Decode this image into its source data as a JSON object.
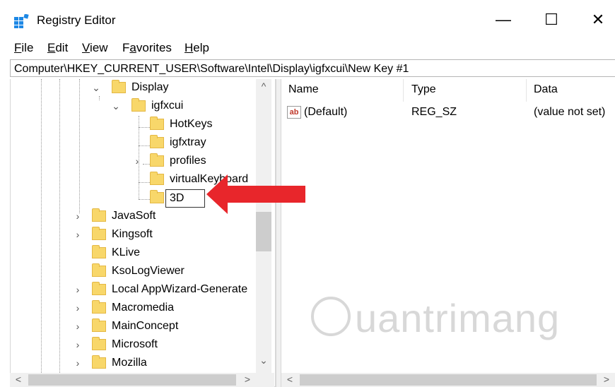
{
  "window": {
    "title": "Registry Editor",
    "minimize_glyph": "—",
    "maximize_glyph": "☐",
    "close_glyph": "✕"
  },
  "menu": {
    "file": {
      "accel": "F",
      "rest": "ile"
    },
    "edit": {
      "accel": "E",
      "rest": "dit"
    },
    "view": {
      "accel": "V",
      "rest": "iew"
    },
    "favorites": {
      "pre": "F",
      "accel": "a",
      "rest": "vorites"
    },
    "help": {
      "accel": "H",
      "rest": "elp"
    }
  },
  "address": "Computer\\HKEY_CURRENT_USER\\Software\\Intel\\Display\\igfxcui\\New Key #1",
  "tree": {
    "display": "Display",
    "igfxcui": "igfxcui",
    "hotkeys": "HotKeys",
    "igfxtray": "igfxtray",
    "profiles": "profiles",
    "virtualkeyboard": "virtualKeyboard",
    "new_key_edit": "3D",
    "javasoft": "JavaSoft",
    "kingsoft": "Kingsoft",
    "klive": "KLive",
    "ksologviewer": "KsoLogViewer",
    "localappwizard": "Local AppWizard-Generate",
    "macromedia": "Macromedia",
    "mainconcept": "MainConcept",
    "microsoft": "Microsoft",
    "mozilla": "Mozilla"
  },
  "list": {
    "columns": {
      "name": "Name",
      "type": "Type",
      "data": "Data"
    },
    "rows": [
      {
        "icon": "ab",
        "name": "(Default)",
        "type": "REG_SZ",
        "data": "(value not set)"
      }
    ]
  },
  "glyphs": {
    "expanded": "⌄",
    "collapsed": "›",
    "scroll_up": "^",
    "scroll_down": "⌄",
    "scroll_left": "<",
    "scroll_right": ">"
  },
  "watermark": "uantrimang",
  "colors": {
    "folder": "#f8d76a",
    "arrow": "#e8262b",
    "scrollbar": "#f0f0f0",
    "thumb": "#cdcdcd"
  },
  "icons": {
    "app": "registry-editor-icon",
    "folder": "folder-icon",
    "string_value": "string-value-icon",
    "annotation": "red-arrow"
  }
}
